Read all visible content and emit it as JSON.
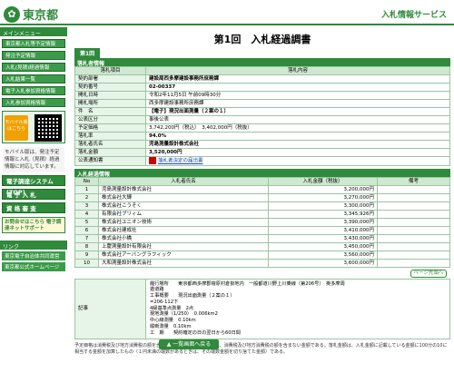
{
  "header": {
    "logo_text": "東京都",
    "service_name": "入札情報サービス"
  },
  "sidebar": {
    "menu_title": "メインメニュー",
    "items": [
      {
        "label": "東京都入札等予定情報"
      },
      {
        "label": "発注予定情報"
      },
      {
        "label": "入札(見積)経過情報"
      },
      {
        "label": "入札結果一覧"
      },
      {
        "label": "電子入札参加資格情報"
      },
      {
        "label": "入札参加資格情報"
      }
    ],
    "mobile_label": "モバイル版",
    "mobile_sub": "はこちら",
    "mobile_note": "モバイル版は、発注予定情報と入札（見積）経過情報に対応しています。",
    "big_buttons": [
      {
        "label": "電子調達システム(TOP)"
      },
      {
        "label": "電 子 入 札"
      },
      {
        "label": "資 格 審 査"
      }
    ],
    "notice_text": "お問合せはこちら 電子調達ネットサポート",
    "links_title": "リンク",
    "links": [
      {
        "label": "東京電子自治体共同運営"
      },
      {
        "label": "東京都公式ホームページ"
      }
    ]
  },
  "main": {
    "page_title": "第1回　入札経過調書",
    "round_tab": "第1回",
    "info_section": "落札者情報",
    "info_headers": [
      "落札項目",
      "落札内容"
    ],
    "info_rows": [
      {
        "label": "契約部署",
        "value": "建設局西多摩建設事務所庶務課",
        "bold": true
      },
      {
        "label": "契約番号",
        "value": "02-00337",
        "bold": true
      },
      {
        "label": "開札日時",
        "value": "令和2年11月5日 午前09時30分",
        "bold": false
      },
      {
        "label": "開札場所",
        "value": "西多摩建設事務所庶務課",
        "bold": false
      },
      {
        "label": "件　名",
        "value": "【電子】現況出面測量（２案の１）",
        "bold": true
      },
      {
        "label": "公表区分",
        "value": "事後公表",
        "bold": false
      },
      {
        "label": "予定価格",
        "value": "3,742,200円（税込）　3,402,000円（税抜）",
        "bold": false
      },
      {
        "label": "落札率",
        "value": "94.0%",
        "bold": true
      },
      {
        "label": "落札者氏名",
        "value": "児島測量設計株式会社",
        "bold": true
      },
      {
        "label": "落札金額",
        "value": "3,520,000円",
        "bold": true
      }
    ],
    "notice_label": "公表通知書",
    "notice_link": "落札者決定の届出書",
    "bid_section": "入札経過情報",
    "bid_headers": [
      "No",
      "入札者氏名",
      "入札金額（税抜）",
      "備考"
    ],
    "bids": [
      {
        "no": "1",
        "name": "児島測量設計株式会社",
        "amount": "3,200,000円",
        "note": ""
      },
      {
        "no": "2",
        "name": "株式会社大輝",
        "amount": "3,270,000円",
        "note": ""
      },
      {
        "no": "3",
        "name": "株式会社こうそく",
        "amount": "3,300,000円",
        "note": ""
      },
      {
        "no": "4",
        "name": "有限会社ブリィム",
        "amount": "3,345,926円",
        "note": ""
      },
      {
        "no": "5",
        "name": "株式会社ユニオン技術",
        "amount": "3,390,000円",
        "note": ""
      },
      {
        "no": "6",
        "name": "株式会社建成社",
        "amount": "3,410,000円",
        "note": ""
      },
      {
        "no": "7",
        "name": "株式会社小橋",
        "amount": "3,430,000円",
        "note": ""
      },
      {
        "no": "8",
        "name": "上慶測量設計有限会社",
        "amount": "3,450,000円",
        "note": ""
      },
      {
        "no": "9",
        "name": "株式会社アーバングラフィック",
        "amount": "3,560,000円",
        "note": ""
      },
      {
        "no": "10",
        "name": "大和測量設計株式会社",
        "amount": "3,600,000円",
        "note": ""
      }
    ],
    "fix_button": "ページ先頭へ",
    "remarks_label": "記事",
    "remarks_lines": [
      "履行場所　　東京都西多摩郡檜原村倉掛地内　一般都道川野上川乗線（第206号）　奥多摩周",
      "遊道路",
      "工事概要　　現況出面測量（２案の１）",
      "=206-112下",
      "4級基準点測量　2点",
      "現地測量（1/250）　0.006km2",
      "中心線測量　0.10km",
      "縦断測量　0.10km",
      "工　期　　契約確定の日の翌日から60日間"
    ],
    "footnote": "予定価格は消費税及び地方消費税の額を含んだ金額であり、入札金額は、消費税及び地方消費税の額を含まない金額である。落札金額は、入札金額に記載している金額に100分の10に相当する金額を加算したもの（１円未満の端数があるときは、その端数金額を切り捨てた金額）である。",
    "back_button": "一覧画面へ戻る"
  }
}
